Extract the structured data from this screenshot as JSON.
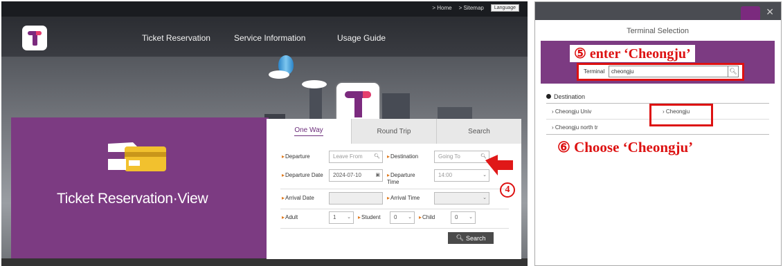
{
  "left": {
    "top_links": [
      "> Home",
      "> Sitemap"
    ],
    "language_button": "Language",
    "nav": [
      "Ticket Reservation",
      "Service Information",
      "Usage Guide"
    ],
    "hero_title": "Ticket Reservation·View",
    "tabs": [
      "One Way",
      "Round Trip",
      "Search"
    ],
    "form": {
      "departure_label": "Departure",
      "departure_placeholder": "Leave From",
      "destination_label": "Destination",
      "destination_placeholder": "Going To",
      "departure_date_label": "Departure Date",
      "departure_date_value": "2024-07-10",
      "departure_time_label": "Departure Time",
      "departure_time_value": "14:00",
      "arrival_date_label": "Arrival Date",
      "arrival_time_label": "Arrival Time",
      "adult_label": "Adult",
      "adult_value": "1",
      "student_label": "Student",
      "student_value": "0",
      "child_label": "Child",
      "child_value": "0",
      "search_button": "Search"
    },
    "step_marker": "4"
  },
  "right": {
    "dialog_title": "Terminal Selection",
    "step5_text": "⑤ enter ‘Cheongju’",
    "terminal_label": "Terminal",
    "terminal_value": "cheongju",
    "destination_header": "Destination",
    "results": [
      "Cheongju Univ",
      "Cheongju",
      "Cheongju north tr"
    ],
    "step6_text": "⑥ Choose ‘Cheongju’"
  },
  "colors": {
    "brand_purple": "#7c3b82",
    "accent_red": "#d11111",
    "accent_orange": "#e07a1f"
  }
}
